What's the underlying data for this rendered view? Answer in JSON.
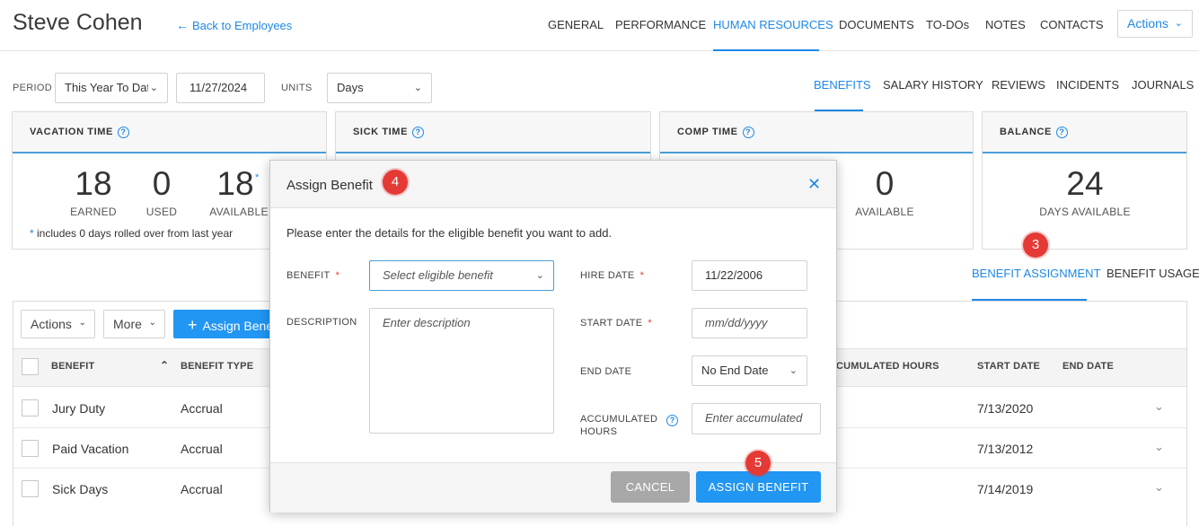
{
  "header": {
    "employee_name": "Steve Cohen",
    "back_link": "Back to Employees",
    "nav": [
      "GENERAL",
      "PERFORMANCE",
      "HUMAN RESOURCES",
      "DOCUMENTS",
      "TO-DOs",
      "NOTES",
      "CONTACTS"
    ],
    "active_nav": "HUMAN RESOURCES",
    "actions_label": "Actions"
  },
  "filters": {
    "period_label": "PERIOD",
    "period_value": "This Year To Date",
    "date_value": "11/27/2024",
    "units_label": "UNITS",
    "units_value": "Days"
  },
  "subnav": [
    "BENEFITS",
    "SALARY HISTORY",
    "REVIEWS",
    "INCIDENTS",
    "JOURNALS"
  ],
  "cards": {
    "vacation": {
      "title": "VACATION TIME",
      "earned": "18",
      "earned_label": "EARNED",
      "used": "0",
      "used_label": "USED",
      "available": "18",
      "available_label": "AVAILABLE",
      "asterisk": "*",
      "note_star": "*",
      "note": "includes 0 days rolled over from last year"
    },
    "sick": {
      "title": "SICK TIME"
    },
    "comp": {
      "title": "COMP TIME",
      "available": "0",
      "available_label": "AVAILABLE"
    },
    "balance": {
      "title": "BALANCE",
      "value": "24",
      "label": "DAYS AVAILABLE"
    }
  },
  "benefit_tabs": [
    "BENEFIT ASSIGNMENT",
    "BENEFIT USAGE"
  ],
  "grid": {
    "toolbar": {
      "actions": "Actions",
      "more": "More",
      "assign": "Assign Benefit"
    },
    "columns": {
      "benefit": "BENEFIT",
      "benefit_type": "BENEFIT TYPE",
      "accumulated_hours": "ACCUMULATED HOURS",
      "start_date": "START DATE",
      "end_date": "END DATE"
    },
    "accumulated_visible": "CUMULATED HOURS",
    "rows": [
      {
        "benefit": "Jury Duty",
        "type": "Accrual",
        "start_date": "7/13/2020",
        "end_date": ""
      },
      {
        "benefit": "Paid Vacation",
        "type": "Accrual",
        "start_date": "7/13/2012",
        "end_date": ""
      },
      {
        "benefit": "Sick Days",
        "type": "Accrual",
        "start_date": "7/14/2019",
        "end_date": ""
      }
    ]
  },
  "modal": {
    "title": "Assign Benefit",
    "intro": "Please enter the details for the eligible benefit you want to add.",
    "benefit_label": "BENEFIT",
    "benefit_placeholder": "Select eligible benefit",
    "description_label": "DESCRIPTION",
    "description_placeholder": "Enter description",
    "hire_date_label": "HIRE DATE",
    "hire_date_value": "11/22/2006",
    "start_date_label": "START DATE",
    "start_date_placeholder": "mm/dd/yyyy",
    "end_date_label": "END DATE",
    "end_date_value": "No End Date",
    "accumulated_label_1": "ACCUMULATED",
    "accumulated_label_2": "HOURS",
    "accumulated_placeholder": "Enter accumulated",
    "required_mark": "*",
    "cancel_label": "CANCEL",
    "assign_label": "ASSIGN BENEFIT"
  },
  "step_badges": {
    "three": "3",
    "four": "4",
    "five": "5"
  },
  "icons": {
    "back": "arrow-left-icon",
    "chevron": "chevron-down-icon",
    "help": "question-circle-icon",
    "close": "close-icon",
    "plus": "plus-icon",
    "sort": "sort-asc-icon"
  },
  "colors": {
    "accent": "#2196f3",
    "link": "#1e88e5",
    "badge": "#e53935",
    "cancel": "#a8a8a8"
  }
}
